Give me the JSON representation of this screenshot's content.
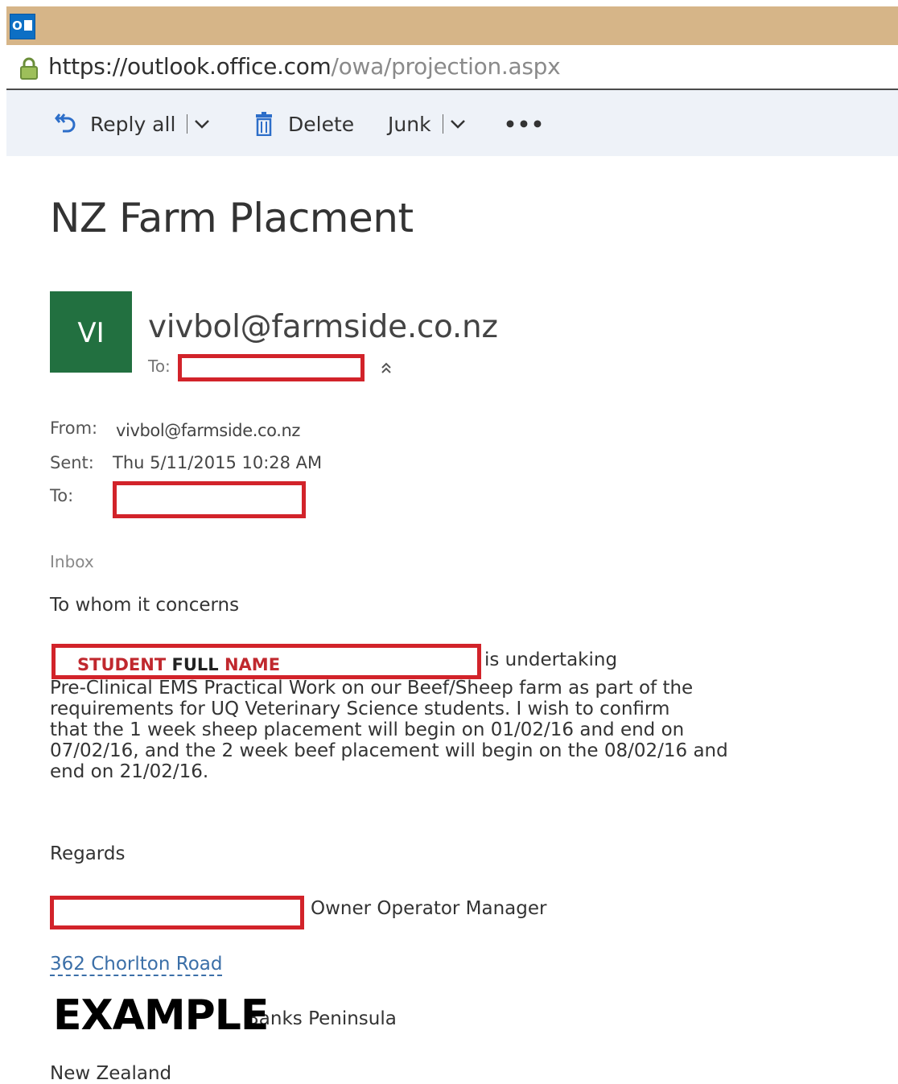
{
  "browser": {
    "app_icon": "outlook-logo-icon",
    "app_icon_text": "O",
    "url_base": "https://outlook.office.com",
    "url_path": "/owa/projection.aspx"
  },
  "toolbar": {
    "reply_all_label": "Reply all",
    "delete_label": "Delete",
    "junk_label": "Junk",
    "more_label": "•••"
  },
  "message": {
    "subject": "NZ Farm Placment",
    "avatar_initials": "VI",
    "sender_email": "vivbol@farmside.co.nz",
    "to_label": "To:",
    "from_label": "From:",
    "from_value": "vivbol@farmside.co.nz",
    "sent_label": "Sent:",
    "sent_value": "Thu 5/11/2015 10:28 AM",
    "to_label_2": "To:",
    "folder": "Inbox"
  },
  "body": {
    "greeting": "To whom it concerns",
    "student_name_part1": "STUDENT ",
    "student_name_part2": "FULL",
    "student_name_part3": " NAME",
    "undertaking": "is undertaking",
    "paragraph": "Pre-Clinical EMS Practical Work on our Beef/Sheep farm as part of the\nrequirements for UQ Veterinary Science students. I wish to confirm\nthat the 1 week sheep placement will begin on 01/02/16 and end on\n07/02/16, and the 2 week beef placement will begin on the 08/02/16 and\nend on 21/02/16.",
    "regards": "Regards",
    "signature_title": "Owner Operator Manager",
    "address_line1": "362 Chorlton Road",
    "address_line2": "Banks Peninsula",
    "address_line3": "New Zealand",
    "watermark": "EXAMPLE"
  },
  "colors": {
    "titlebar": "#d6b588",
    "avatar": "#227040",
    "redaction": "#d2232a",
    "link": "#3b6fa8"
  }
}
